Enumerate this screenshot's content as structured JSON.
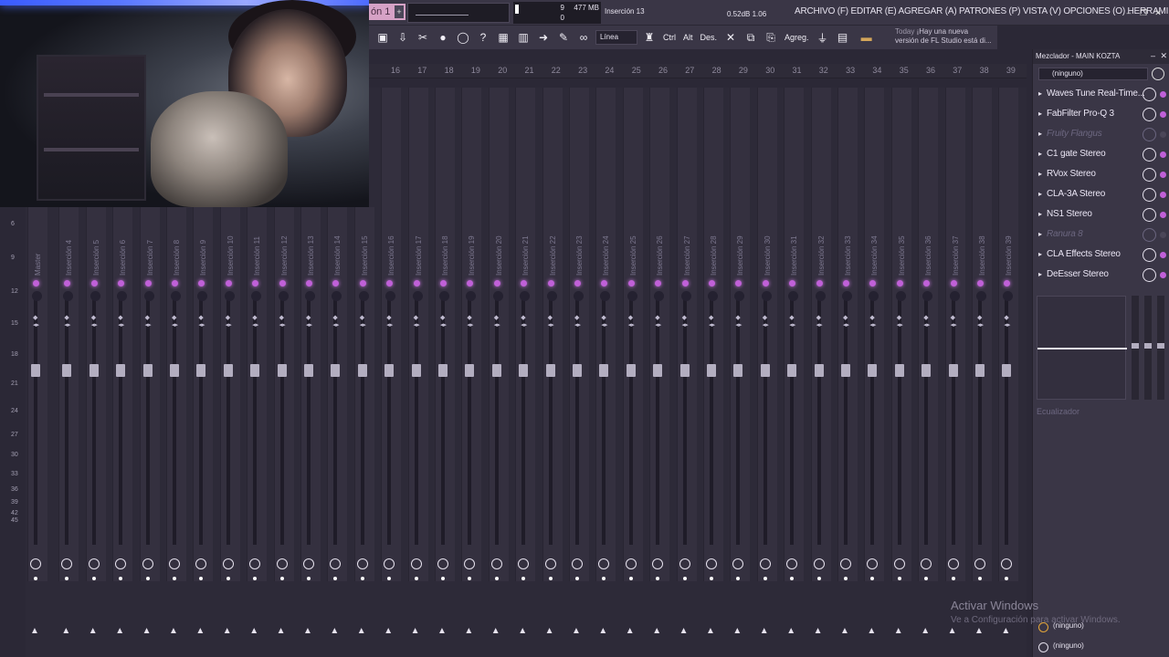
{
  "topbar": {
    "pattern": "ón 1",
    "cpu_value": "9",
    "ram": "477 MB",
    "polyphony": "0",
    "hint": "Inserción 13",
    "db": "0.52dB",
    "ratio": "1.06",
    "menu": "ARCHIVO (F)  EDITAR (E)  AGREGAR (A)  PATRONES (P)  VISTA (V)  OPCIONES (O)  HERRAMIENTAS (T)  AYUDA"
  },
  "toolbar": {
    "mode": "Línea",
    "ctrl": "Ctrl",
    "alt": "Alt",
    "des": "Des.",
    "agreg": "Agreg.",
    "news_today": "Today",
    "news_line1": "¡Hay una nueva",
    "news_line2": "versión de FL Studio está di..."
  },
  "ruler": [
    "16",
    "17",
    "18",
    "19",
    "20",
    "21",
    "22",
    "23",
    "24",
    "25",
    "26",
    "27",
    "28",
    "29",
    "30",
    "31",
    "32",
    "33",
    "34",
    "35",
    "36",
    "37",
    "38",
    "39"
  ],
  "scale": [
    "6",
    "9",
    "12",
    "15",
    "18",
    "21",
    "24",
    "27",
    "30",
    "33",
    "36",
    "39",
    "42",
    "45"
  ],
  "tracks": [
    "Master",
    "Inserción 4",
    "Inserción 5",
    "Inserción 6",
    "Inserción 7",
    "Inserción 8",
    "Inserción 9",
    "Inserción 10",
    "Inserción 11",
    "Inserción 12",
    "Inserción 13",
    "Inserción 14",
    "Inserción 15",
    "Inserción 16",
    "Inserción 17",
    "Inserción 18",
    "Inserción 19",
    "Inserción 20",
    "Inserción 21",
    "Inserción 22",
    "Inserción 23",
    "Inserción 24",
    "Inserción 25",
    "Inserción 26",
    "Inserción 27",
    "Inserción 28",
    "Inserción 29",
    "Inserción 30",
    "Inserción 31",
    "Inserción 32",
    "Inserción 33",
    "Inserción 34",
    "Inserción 35",
    "Inserción 36",
    "Inserción 37",
    "Inserción 38",
    "Inserción 39"
  ],
  "panel": {
    "title": "Mezclador - MAIN KOZTA",
    "input": "(ninguno)",
    "slots": [
      {
        "name": "Waves Tune Real-Time...",
        "on": true
      },
      {
        "name": "FabFilter Pro-Q 3",
        "on": true
      },
      {
        "name": "Fruity Flangus",
        "on": false
      },
      {
        "name": "C1 gate Stereo",
        "on": true
      },
      {
        "name": "RVox Stereo",
        "on": true
      },
      {
        "name": "CLA-3A Stereo",
        "on": true
      },
      {
        "name": "NS1 Stereo",
        "on": true
      },
      {
        "name": "Ranura 8",
        "on": false
      },
      {
        "name": "CLA Effects Stereo",
        "on": true
      },
      {
        "name": "DeEsser Stereo",
        "on": true
      }
    ],
    "eq_label": "Ecualizador",
    "out1": "(ninguno)",
    "out2": "(ninguno)"
  },
  "watermark": {
    "line1": "Activar Windows",
    "line2": "Ve a Configuración para activar Windows."
  }
}
